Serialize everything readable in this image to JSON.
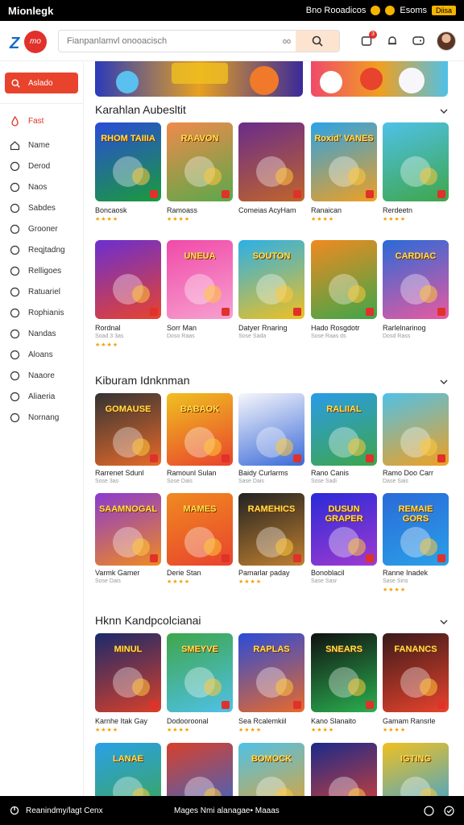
{
  "status": {
    "brand": "Mionlegk",
    "right_text": "Bno Rooadicos",
    "coin_text": "Esoms",
    "badge": "Diisa"
  },
  "search": {
    "placeholder": "Fianpanlamvl onooacisch",
    "dropdown": "oo",
    "notif_count": "3"
  },
  "sidebar": {
    "play_label": "Aslado",
    "items": [
      {
        "label": "Fast",
        "icon": "flame-icon",
        "active": true
      },
      {
        "label": "Name",
        "icon": "home-icon"
      },
      {
        "label": "Derod",
        "icon": "compass-icon"
      },
      {
        "label": "Naos",
        "icon": "clock-icon"
      },
      {
        "label": "Sabdes",
        "icon": "grid-icon"
      },
      {
        "label": "Grooner",
        "icon": "controller-icon"
      },
      {
        "label": "Reqjtadng",
        "icon": "chart-icon"
      },
      {
        "label": "Relligoes",
        "icon": "heart-icon"
      },
      {
        "label": "Ratuariel",
        "icon": "users-icon"
      },
      {
        "label": "Rophianis",
        "icon": "puzzle-icon"
      },
      {
        "label": "Nandas",
        "icon": "star-icon"
      },
      {
        "label": "Aloans",
        "icon": "bell-icon"
      },
      {
        "label": "Naaore",
        "icon": "dice-icon"
      },
      {
        "label": "Aliaeria",
        "icon": "book-icon"
      },
      {
        "label": "Nornang",
        "icon": "chat-icon"
      }
    ]
  },
  "sections": [
    {
      "title": "Karahlan Aubesltit",
      "games": [
        {
          "name": "Boncaosk",
          "sub": "",
          "stars": "★★★★",
          "art": "RHOM TAIIIA",
          "c1": "#2a4bd8",
          "c2": "#1a9b3b"
        },
        {
          "name": "Ramoass",
          "sub": "",
          "stars": "★★★★",
          "art": "RAAVON",
          "c1": "#f08a4b",
          "c2": "#5ba84a"
        },
        {
          "name": "Comeias AcyHam",
          "sub": "",
          "stars": "",
          "art": "",
          "c1": "#6a2c8a",
          "c2": "#c0652a"
        },
        {
          "name": "Ranaican",
          "sub": "",
          "stars": "★★★★",
          "art": "Roxid' VANES",
          "c1": "#2aa2e8",
          "c2": "#f0a020"
        },
        {
          "name": "Rerdeetn",
          "sub": "",
          "stars": "★★★★",
          "art": "",
          "c1": "#4fc1e8",
          "c2": "#3ea64a"
        },
        {
          "name": "Rordnal",
          "sub": "Soad 3 3as",
          "stars": "★★★★",
          "art": "",
          "c1": "#6a2fd0",
          "c2": "#e8432d"
        },
        {
          "name": "Sorr Man",
          "sub": "Doso Raas",
          "stars": "",
          "art": "UNEUA",
          "c1": "#f04aa8",
          "c2": "#f7a0d0"
        },
        {
          "name": "Datyer Rnaring",
          "sub": "Sose Sada",
          "stars": "",
          "art": "SOUTON",
          "c1": "#2ab0e8",
          "c2": "#f0c020"
        },
        {
          "name": "Hado Rosgdotr",
          "sub": "Sose Raas ds",
          "stars": "",
          "art": "",
          "c1": "#f08a20",
          "c2": "#3ea64a"
        },
        {
          "name": "Rarlelnarinog",
          "sub": "Dosd Rass",
          "stars": "",
          "art": "CARDIAC",
          "c1": "#2a6ad8",
          "c2": "#e85aa0"
        }
      ]
    },
    {
      "title": "Kiburam Idnknman",
      "games": [
        {
          "name": "Rarrenet Sdunl",
          "sub": "Sose 3as",
          "stars": "",
          "art": "GOMAUSE",
          "c1": "#333333",
          "c2": "#e86a2a"
        },
        {
          "name": "Ramounl Sulan",
          "sub": "Sose Dais",
          "stars": "",
          "art": "BABAOK",
          "c1": "#f0c020",
          "c2": "#e8432d"
        },
        {
          "name": "Baidy Curlarms",
          "sub": "Sase Dais",
          "stars": "",
          "art": "",
          "c1": "#f7f7fb",
          "c2": "#3a6ad8"
        },
        {
          "name": "Rano Canis",
          "sub": "Sose Sadi",
          "stars": "",
          "art": "RALIIAL",
          "c1": "#2a9be8",
          "c2": "#3ea64a"
        },
        {
          "name": "Ramo Doo Carr",
          "sub": "Dase Sais",
          "stars": "",
          "art": "",
          "c1": "#4fc1e8",
          "c2": "#f0a020"
        },
        {
          "name": "Varmk Gamer",
          "sub": "Sose Dais",
          "stars": "",
          "art": "SAAMNOGAL",
          "c1": "#8a3ad0",
          "c2": "#f08a20"
        },
        {
          "name": "Derie Stan",
          "sub": "",
          "stars": "★★★★",
          "art": "MAMES",
          "c1": "#f08a20",
          "c2": "#e8432d"
        },
        {
          "name": "Pamarlar paday",
          "sub": "",
          "stars": "★★★★",
          "art": "RAMEHICS",
          "c1": "#222222",
          "c2": "#c08030"
        },
        {
          "name": "Bonoblacil",
          "sub": "Sase Sasr",
          "stars": "",
          "art": "DUSUN GRAPER",
          "c1": "#2a2ad8",
          "c2": "#a03ad0"
        },
        {
          "name": "Ranne Inadek",
          "sub": "Sase Sins",
          "stars": "★★★★",
          "art": "REMAIE GORS",
          "c1": "#2a6ad8",
          "c2": "#2aa0e8"
        }
      ]
    },
    {
      "title": "Hknn Kandpcolcianai",
      "games": [
        {
          "name": "Karnhe Itak Gay",
          "sub": "",
          "stars": "★★★★",
          "art": "MINUL",
          "c1": "#1a2a6a",
          "c2": "#d8402a"
        },
        {
          "name": "Dodooroonal",
          "sub": "",
          "stars": "★★★★",
          "art": "SMEYVE",
          "c1": "#3ea64a",
          "c2": "#4fc1e8"
        },
        {
          "name": "Sea Rcalemkiil",
          "sub": "",
          "stars": "★★★★",
          "art": "RAPLAS",
          "c1": "#2a4bd8",
          "c2": "#e86a2a"
        },
        {
          "name": "Kano Slanaito",
          "sub": "",
          "stars": "★★★★",
          "art": "SNEARS",
          "c1": "#111111",
          "c2": "#2ab050"
        },
        {
          "name": "Gamam Ransrle",
          "sub": "",
          "stars": "★★★★",
          "art": "FANANCS",
          "c1": "#3a1a1a",
          "c2": "#e8432d"
        },
        {
          "name": "",
          "sub": "",
          "stars": "",
          "art": "LANAE",
          "c1": "#2aa0e8",
          "c2": "#3ea64a"
        },
        {
          "name": "",
          "sub": "",
          "stars": "",
          "art": "",
          "c1": "#d8402a",
          "c2": "#2a6ad8"
        },
        {
          "name": "",
          "sub": "",
          "stars": "",
          "art": "BOMOCK",
          "c1": "#4fc1e8",
          "c2": "#f0a020"
        },
        {
          "name": "",
          "sub": "",
          "stars": "",
          "art": "",
          "c1": "#1a2a8a",
          "c2": "#e8432d"
        },
        {
          "name": "",
          "sub": "",
          "stars": "",
          "art": "IGTING",
          "c1": "#f0c020",
          "c2": "#2aa0e8"
        }
      ]
    }
  ],
  "bottom": {
    "left": "Reanindmy/lagt Cenx",
    "center": "Mages Nmi alanagae• Maaas"
  }
}
